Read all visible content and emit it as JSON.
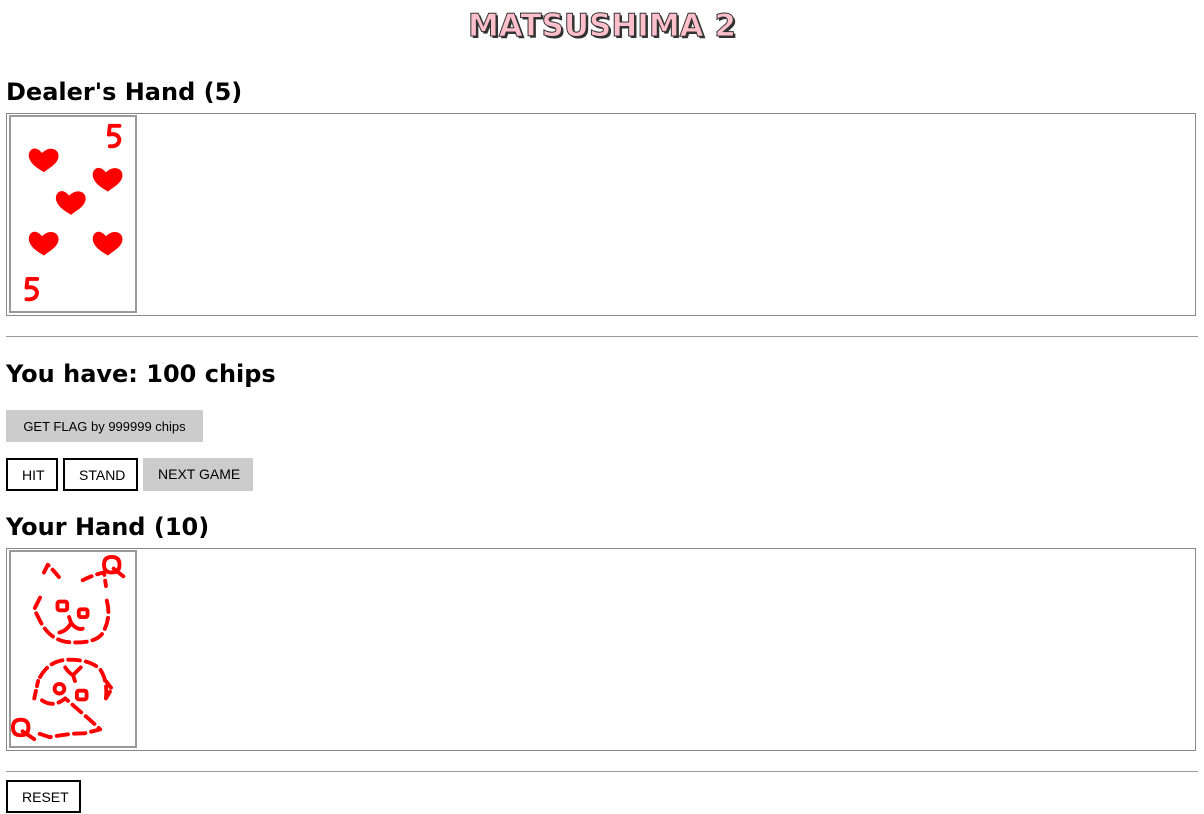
{
  "title": "MATSUSHIMA 2",
  "dealer": {
    "heading": "Dealer's Hand (5)",
    "cards": [
      {
        "rank": "5",
        "suit": "hearts"
      }
    ]
  },
  "chips": {
    "text": "You have: 100 chips"
  },
  "buttons": {
    "get_flag": "GET FLAG by 999999 chips",
    "hit": "HIT",
    "stand": "STAND",
    "next_game": "NEXT GAME",
    "reset": "RESET"
  },
  "player": {
    "heading": "Your Hand (10)",
    "cards": [
      {
        "rank": "Q",
        "suit": "cat"
      }
    ]
  },
  "colors": {
    "card_ink": "#ff0000",
    "title_fill": "#ffc0cb",
    "gray_button": "#cccccc"
  }
}
